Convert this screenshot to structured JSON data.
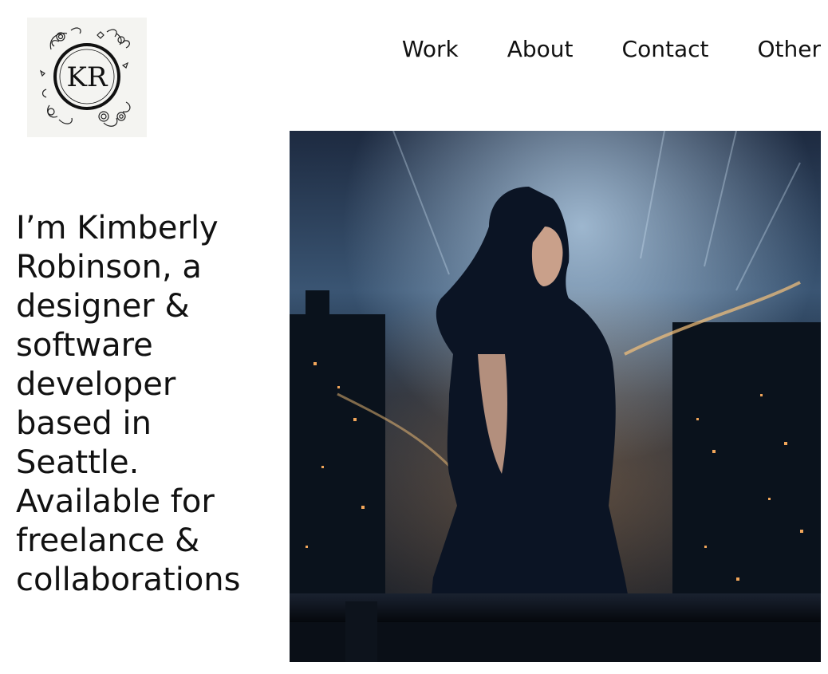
{
  "logo": {
    "monogram": "KR",
    "icon": "floral-wreath-monogram-icon"
  },
  "nav": {
    "items": [
      {
        "label": "Work"
      },
      {
        "label": "About"
      },
      {
        "label": "Contact"
      },
      {
        "label": "Other"
      }
    ]
  },
  "hero": {
    "intro_text": "I’m Kimberly Robinson, a designer & software developer based in Seattle. Available for freelance & collaborations",
    "image_subject": "woman-overlooking-night-city-image"
  },
  "colors": {
    "text": "#111111",
    "background": "#ffffff",
    "logo_bg": "#f4f4f1",
    "night_sky": "#0f1a2b",
    "city_lights": "#f2a65a"
  }
}
